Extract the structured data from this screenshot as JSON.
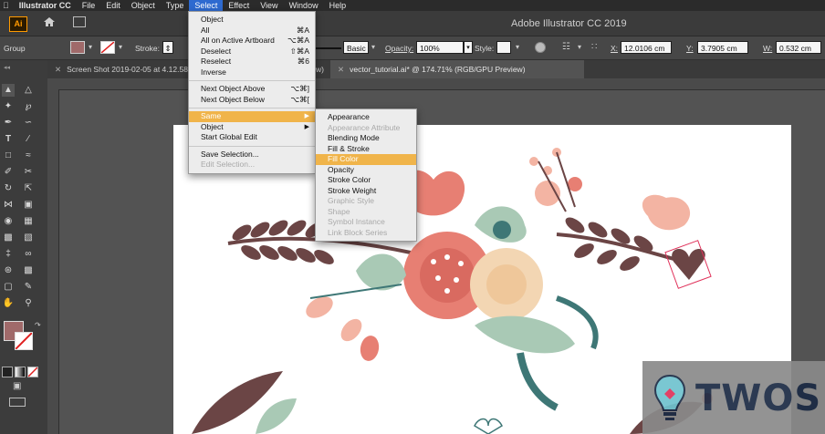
{
  "menubar": {
    "apple": "",
    "app_name": "Illustrator CC",
    "items": [
      "File",
      "Edit",
      "Object",
      "Type",
      "Select",
      "Effect",
      "View",
      "Window",
      "Help"
    ]
  },
  "app": {
    "title": "Adobe Illustrator CC 2019"
  },
  "control_bar": {
    "selection_label": "Group",
    "stroke_label": "Stroke:",
    "brush_label": "Basic",
    "opacity_label": "Opacity:",
    "opacity_value": "100%",
    "style_label": "Style:",
    "x_label": "X:",
    "x_value": "12.0106 cm",
    "y_label": "Y:",
    "y_value": "3.7905 cm",
    "w_label": "W:",
    "w_value": "0.532 cm",
    "fill_color": "#a06a6a"
  },
  "tabs": [
    {
      "label": "Screen Shot 2019-02-05 at 4.12.58"
    },
    {
      "label": "vector_tutorial.ai* @ 174.71% (RGB/GPU Preview)"
    }
  ],
  "tab_partial": "w)",
  "select_menu": {
    "items": [
      {
        "label": "Object",
        "shortcut": ""
      },
      {
        "label": "All",
        "shortcut": "⌘A"
      },
      {
        "label": "All on Active Artboard",
        "shortcut": "⌥⌘A"
      },
      {
        "label": "Deselect",
        "shortcut": "⇧⌘A"
      },
      {
        "label": "Reselect",
        "shortcut": "⌘6"
      },
      {
        "label": "Inverse",
        "shortcut": ""
      },
      {
        "label": "Next Object Above",
        "shortcut": "⌥⌘]"
      },
      {
        "label": "Next Object Below",
        "shortcut": "⌥⌘["
      },
      {
        "label": "Same",
        "shortcut": ""
      },
      {
        "label": "Object",
        "shortcut": ""
      },
      {
        "label": "Start Global Edit",
        "shortcut": ""
      },
      {
        "label": "Save Selection...",
        "shortcut": ""
      },
      {
        "label": "Edit Selection...",
        "shortcut": ""
      }
    ]
  },
  "same_submenu": {
    "items": [
      {
        "label": "Appearance"
      },
      {
        "label": "Appearance Attribute"
      },
      {
        "label": "Blending Mode"
      },
      {
        "label": "Fill & Stroke"
      },
      {
        "label": "Fill Color"
      },
      {
        "label": "Opacity"
      },
      {
        "label": "Stroke Color"
      },
      {
        "label": "Stroke Weight"
      },
      {
        "label": "Graphic Style"
      },
      {
        "label": "Shape"
      },
      {
        "label": "Symbol Instance"
      },
      {
        "label": "Link Block Series"
      }
    ]
  },
  "watermark": {
    "text": "TWOS"
  },
  "colors": {
    "highlight": "#f0b44a",
    "menu_active": "#2e6ad0",
    "coral": "#e77f73",
    "teal": "#3e7776",
    "mint": "#a9c9b5",
    "brown": "#6b4545",
    "cream": "#f3d6b3",
    "pink": "#f3b4a3"
  }
}
